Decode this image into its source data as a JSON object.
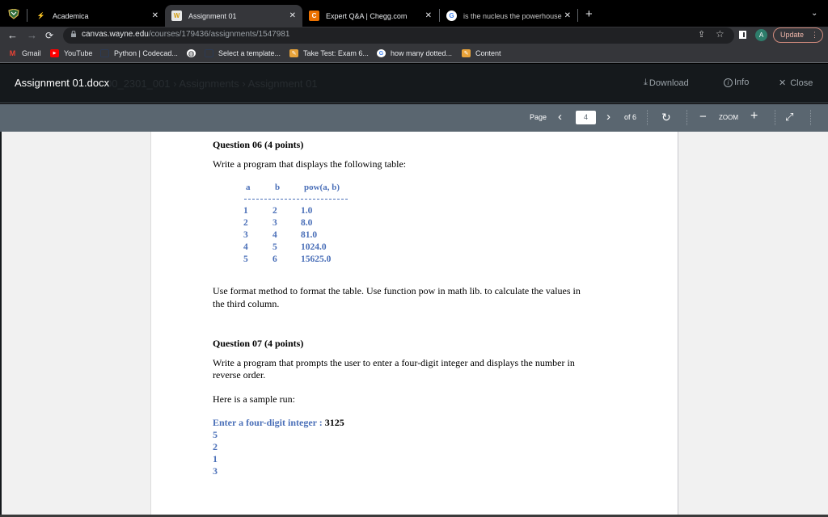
{
  "browser": {
    "tabs": [
      {
        "label": "Academica",
        "icon": "academica-icon",
        "active": false
      },
      {
        "label": "Assignment 01",
        "icon": "wayne-state-icon",
        "active": true
      },
      {
        "label": "Expert Q&A | Chegg.com",
        "icon": "chegg-icon",
        "active": false
      },
      {
        "label": "is the nucleus the powerhouse",
        "icon": "google-icon",
        "active": false
      }
    ],
    "new_tab": "+",
    "address": {
      "domain": "canvas.wayne.edu",
      "path": "/courses/179436/assignments/1547981"
    },
    "profile_initial": "A",
    "update_label": "Update",
    "bookmarks": [
      {
        "label": "Gmail",
        "icon": "gmail-icon"
      },
      {
        "label": "YouTube",
        "icon": "youtube-icon"
      },
      {
        "label": "Python | Codecad...",
        "icon": "codecademy-icon"
      },
      {
        "label": "",
        "icon": "globe-icon"
      },
      {
        "label": "Select a template...",
        "icon": "page-icon"
      },
      {
        "label": "Take Test: Exam 6...",
        "icon": "pencil-icon"
      },
      {
        "label": "how many dotted...",
        "icon": "google-icon"
      },
      {
        "label": "Content",
        "icon": "pencil-icon"
      }
    ]
  },
  "viewer": {
    "title": "Assignment 01.docx",
    "ghost_breadcrumb": "00_2301_001  ›  Assignments  ›  Assignment 01",
    "download_label": "Download",
    "info_label": "Info",
    "close_label": "Close",
    "page_label": "Page",
    "current_page": "4",
    "of_label": "of 6",
    "zoom_label": "ZOOM"
  },
  "document": {
    "q6_title": "Question 06 (4 points)",
    "q6_prompt": "Write a program that displays the following table:",
    "table": {
      "headers": [
        "a",
        "b",
        "pow(a, b)"
      ],
      "rows": [
        [
          "1",
          "2",
          "1.0"
        ],
        [
          "2",
          "3",
          "8.0"
        ],
        [
          "3",
          "4",
          "81.0"
        ],
        [
          "4",
          "5",
          "1024.0"
        ],
        [
          "5",
          "6",
          "15625.0"
        ]
      ]
    },
    "q6_note_line1": "Use format method to format the table. Use function pow in math lib. to calculate the values in",
    "q6_note_line2": "the third column.",
    "q7_title": "Question 07 (4 points)",
    "q7_prompt_line1": "Write a program that prompts the user to enter a four-digit integer and displays the number in",
    "q7_prompt_line2": "reverse order.",
    "sample_run_label": "Here is a sample run:",
    "sample_prompt": "Enter a four-digit integer : ",
    "sample_input": "3125",
    "sample_output": [
      "5",
      "2",
      "1",
      "3"
    ]
  },
  "colors": {
    "accent_blue": "#4a6fb8",
    "viewer_bar": "#5a6670",
    "header_bg": "#15191c"
  }
}
